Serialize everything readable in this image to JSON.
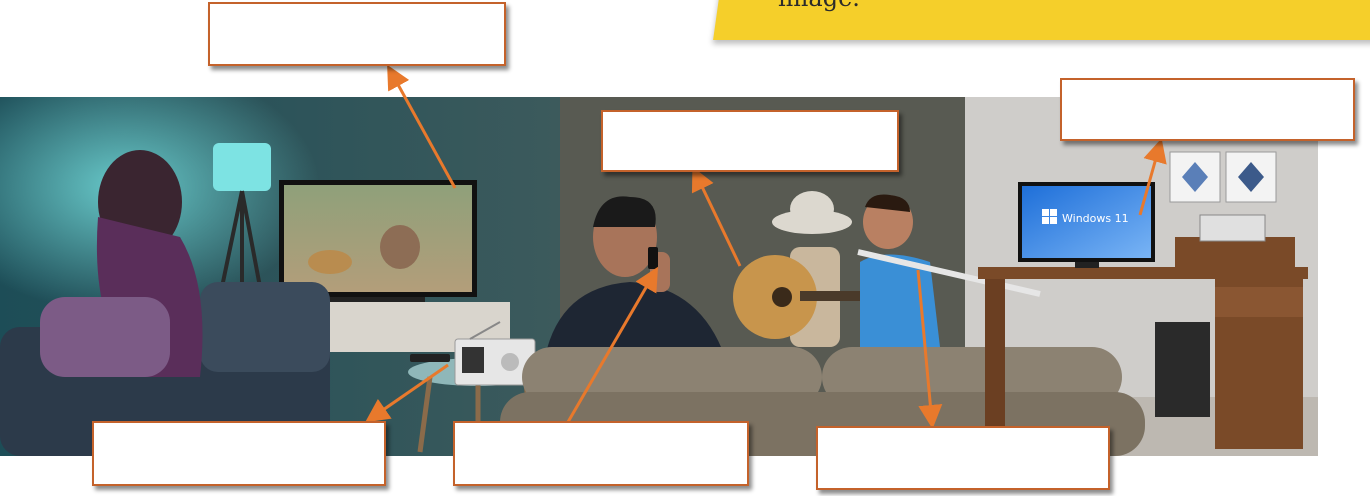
{
  "banner": {
    "text": "image."
  },
  "labels": [
    {
      "id": "tv",
      "text": ""
    },
    {
      "id": "guitar",
      "text": ""
    },
    {
      "id": "computer",
      "text": ""
    },
    {
      "id": "radio",
      "text": ""
    },
    {
      "id": "phone",
      "text": ""
    },
    {
      "id": "flute",
      "text": ""
    }
  ],
  "screen_text": "Windows 11",
  "colors": {
    "arrow": "#e8792c",
    "box_border": "#c4622b",
    "banner": "#f5cf2a"
  }
}
